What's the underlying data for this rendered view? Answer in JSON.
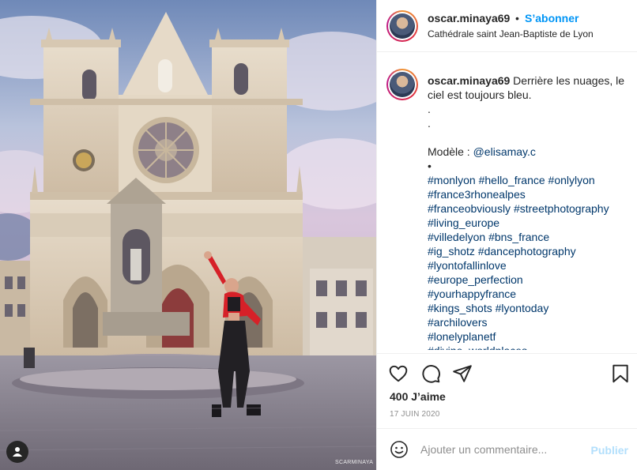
{
  "post": {
    "username": "oscar.minaya69",
    "separator": "•",
    "follow_label": "S’abonner",
    "location": "Cathédrale saint Jean-Baptiste de Lyon"
  },
  "caption": {
    "username": "oscar.minaya69",
    "first_line": " Derrière les nuages, le ciel est toujours bleu.",
    "dot1": ".",
    "dot2": ".",
    "model_label": "Modèle : ",
    "model_mention": "@elisamay.c",
    "bullet": "•",
    "hashtag_lines": [
      [
        "#monlyon",
        "#hello_france",
        "#onlylyon"
      ],
      [
        "#france3rhonealpes"
      ],
      [
        "#franceobviously",
        "#streetphotography"
      ],
      [
        "#living_europe"
      ],
      [
        "#villedelyon",
        "#bns_france"
      ],
      [
        "#ig_shotz",
        "#dancephotography"
      ],
      [
        "#lyontofallinlove"
      ],
      [
        "#europe_perfection"
      ],
      [
        "#yourhappyfrance"
      ],
      [
        "#kings_shots",
        "#lyontoday"
      ],
      [
        "#archilovers"
      ],
      [
        "#lonelyplanetf"
      ],
      [
        "#divine_worldplaces"
      ]
    ]
  },
  "actions": {
    "likes": "400 J’aime",
    "date": "17 JUIN 2020",
    "icons": [
      "heart-icon",
      "comment-icon",
      "share-icon",
      "bookmark-icon"
    ]
  },
  "comment": {
    "placeholder": "Ajouter un commentaire...",
    "publish_label": "Publier"
  },
  "photo": {
    "watermark": "SCARMINAYA",
    "tag_icon": "user-icon"
  },
  "colors": {
    "link_blue": "#0095f6",
    "hashtag": "#00376b",
    "publish_disabled": "#b2dffc",
    "muted": "#8e8e8e"
  }
}
